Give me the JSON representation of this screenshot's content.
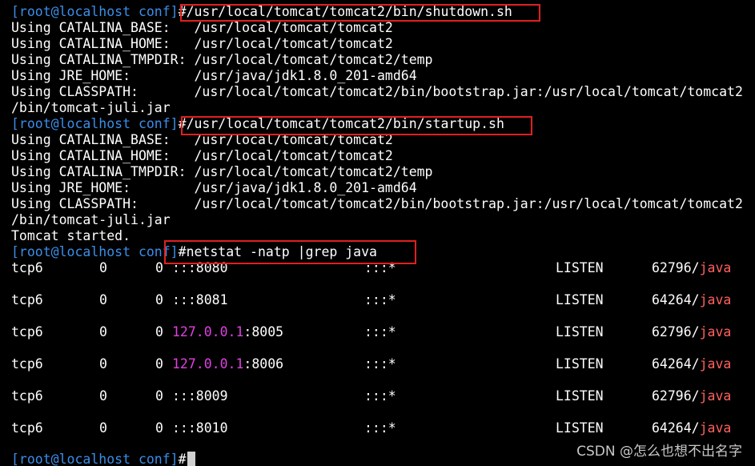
{
  "terminal": {
    "prompt": "[root@localhost conf]",
    "hash": "#",
    "cmd_shutdown": "/usr/local/tomcat/tomcat2/bin/shutdown.sh",
    "cmd_startup": "/usr/local/tomcat/tomcat2/bin/startup.sh",
    "cmd_netstat": "netstat -natp |grep java",
    "env_block_1": [
      "Using CATALINA_BASE:   /usr/local/tomcat/tomcat2",
      "Using CATALINA_HOME:   /usr/local/tomcat/tomcat2",
      "Using CATALINA_TMPDIR: /usr/local/tomcat/tomcat2/temp",
      "Using JRE_HOME:        /usr/java/jdk1.8.0_201-amd64",
      "Using CLASSPATH:       /usr/local/tomcat/tomcat2/bin/bootstrap.jar:/usr/local/tomcat/tomcat2",
      "/bin/tomcat-juli.jar"
    ],
    "env_block_2": [
      "Using CATALINA_BASE:   /usr/local/tomcat/tomcat2",
      "Using CATALINA_HOME:   /usr/local/tomcat/tomcat2",
      "Using CATALINA_TMPDIR: /usr/local/tomcat/tomcat2/temp",
      "Using JRE_HOME:        /usr/java/jdk1.8.0_201-amd64",
      "Using CLASSPATH:       /usr/local/tomcat/tomcat2/bin/bootstrap.jar:/usr/local/tomcat/tomcat2",
      "/bin/tomcat-juli.jar"
    ],
    "started_msg": "Tomcat started.",
    "netstat_rows": [
      {
        "proto": "tcp6",
        "recvq": "0",
        "sendq": "0",
        "local_ip": "",
        "local_addr": ":::8080",
        "foreign": ":::*",
        "state": "LISTEN",
        "pid": "62796/",
        "prog": "java"
      },
      {
        "proto": "tcp6",
        "recvq": "0",
        "sendq": "0",
        "local_ip": "",
        "local_addr": ":::8081",
        "foreign": ":::*",
        "state": "LISTEN",
        "pid": "64264/",
        "prog": "java"
      },
      {
        "proto": "tcp6",
        "recvq": "0",
        "sendq": "0",
        "local_ip": "127.0.0.1",
        "local_addr": ":8005",
        "foreign": ":::*",
        "state": "LISTEN",
        "pid": "62796/",
        "prog": "java"
      },
      {
        "proto": "tcp6",
        "recvq": "0",
        "sendq": "0",
        "local_ip": "127.0.0.1",
        "local_addr": ":8006",
        "foreign": ":::*",
        "state": "LISTEN",
        "pid": "64264/",
        "prog": "java"
      },
      {
        "proto": "tcp6",
        "recvq": "0",
        "sendq": "0",
        "local_ip": "",
        "local_addr": ":::8009",
        "foreign": ":::*",
        "state": "LISTEN",
        "pid": "62796/",
        "prog": "java"
      },
      {
        "proto": "tcp6",
        "recvq": "0",
        "sendq": "0",
        "local_ip": "",
        "local_addr": ":::8010",
        "foreign": ":::*",
        "state": "LISTEN",
        "pid": "64264/",
        "prog": "java"
      }
    ]
  },
  "watermark": "CSDN @怎么也想不出名字",
  "colors": {
    "background": "#000000",
    "prompt": "#3b8eea",
    "ip": "#e040e0",
    "java": "#ff6060",
    "highlight_box": "#e02020"
  }
}
